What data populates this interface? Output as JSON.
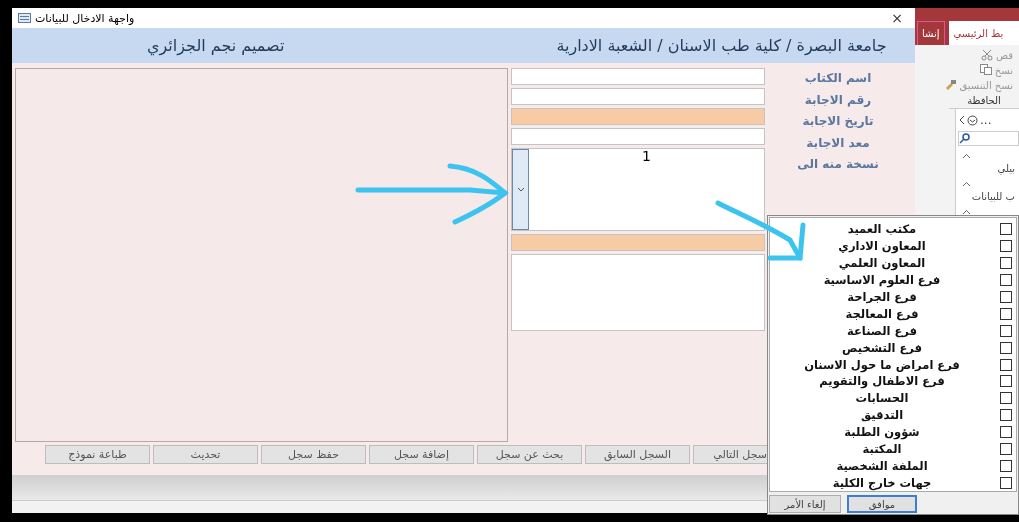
{
  "window": {
    "title": "واجهة الادخال للبيانات",
    "close": "×"
  },
  "header": {
    "title": "جامعة البصرة / كلية طب الاسنان / الشعبة الادارية",
    "credit": "تصميم نجم الجزائري"
  },
  "labels": [
    "اسم الكتاب",
    "رقم الاجابة",
    "تاريخ الاجابة",
    "معد الاجابة",
    "نسخة منه الى"
  ],
  "fields": [
    {
      "kind": "text",
      "highlighted": false
    },
    {
      "kind": "text",
      "highlighted": false
    },
    {
      "kind": "text",
      "highlighted": true
    },
    {
      "kind": "text",
      "highlighted": false
    },
    {
      "kind": "combo",
      "value": "1"
    },
    {
      "kind": "text",
      "highlighted": true
    },
    {
      "kind": "memo"
    }
  ],
  "buttons": [
    "سجل التالي",
    "السجل السابق",
    "بحث عن سجل",
    "إضافة سجل",
    "حفظ سجل",
    "تحديث",
    "طباعة نموذج"
  ],
  "ribbon": {
    "tabs": [
      {
        "label": "يط الرئيسي",
        "selected": true
      },
      {
        "label": "إنشا",
        "selected": false
      }
    ],
    "commands": [
      {
        "label": "قص",
        "kind": "cut"
      },
      {
        "label": "نسخ",
        "kind": "copy"
      },
      {
        "label": "نسخ التنسيق",
        "kind": "format"
      }
    ],
    "group": "الحافظة",
    "nav_title": "...",
    "nav_items": [
      "بيلي",
      "ب للبيانات"
    ]
  },
  "dropdown": {
    "items": [
      {
        "label": "مكتب العميد",
        "checked": false
      },
      {
        "label": "المعاون الاداري",
        "checked": false
      },
      {
        "label": "المعاون العلمي",
        "checked": false
      },
      {
        "label": "فرع العلوم الاساسية",
        "checked": false
      },
      {
        "label": "فرع الجراحة",
        "checked": false
      },
      {
        "label": "فرع المعالجة",
        "checked": false
      },
      {
        "label": "فرع الصناعة",
        "checked": false
      },
      {
        "label": "فرع التشخيص",
        "checked": false
      },
      {
        "label": "فرع امراض ما حول الاسنان",
        "checked": false
      },
      {
        "label": "فرع الاطفال والتقويم",
        "checked": false
      },
      {
        "label": "الحسابات",
        "checked": false
      },
      {
        "label": "التدقيق",
        "checked": false
      },
      {
        "label": "شؤون الطلبة",
        "checked": false
      },
      {
        "label": "المكتبة",
        "checked": false
      },
      {
        "label": "الملفة الشخصية",
        "checked": false
      },
      {
        "label": "جهات خارج الكلية",
        "checked": false
      }
    ],
    "buttons": [
      {
        "label": "موافق",
        "focused": true
      },
      {
        "label": "إلغاء الأمر",
        "focused": false
      }
    ]
  }
}
